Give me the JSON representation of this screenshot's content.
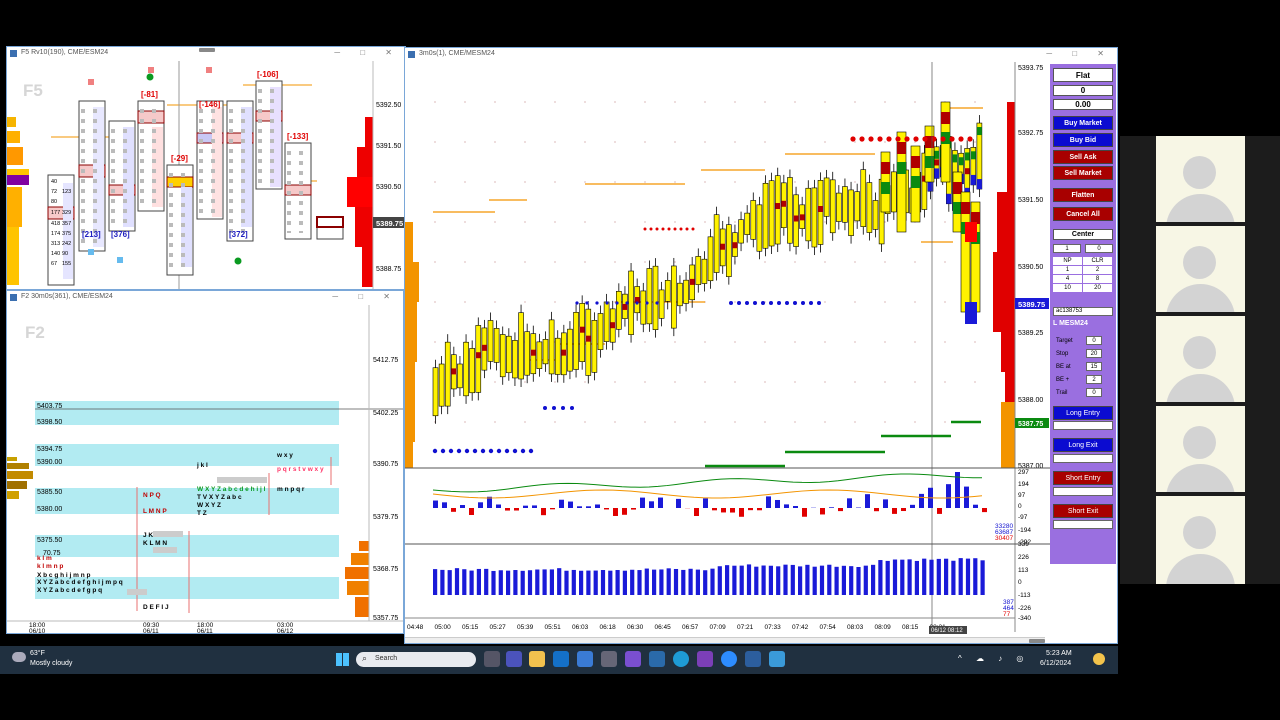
{
  "windows": {
    "left_top": {
      "title": "F5 Rv10(190), CME/ESM24",
      "big_label": "F5",
      "price_axis": [
        "5392.50",
        "5391.50",
        "5390.50",
        "5389.75",
        "5388.75"
      ],
      "current_price": "5389.75",
      "deltas": [
        "[-81]",
        "[-146]",
        "[-106]",
        "[-29]",
        "[-133]",
        "[213]",
        "[376]",
        "[372]"
      ],
      "footprint_numbers": [
        "40",
        "72",
        "80",
        "123",
        "177",
        "329",
        "418",
        "357",
        "174",
        "375",
        "313",
        "242",
        "140",
        "90",
        "67",
        "155"
      ]
    },
    "left_bottom": {
      "title": "F2 30m0s(361), CME/ESM24",
      "big_label": "F2",
      "price_axis": [
        "5412.75",
        "5402.25",
        "5390.75",
        "5379.75",
        "5368.75",
        "5357.75"
      ],
      "levels": [
        "5403.75",
        "5398.50",
        "5394.75",
        "5390.00",
        "5385.50",
        "5380.00",
        "5375.50",
        "70.75"
      ],
      "tpo_rows": [
        "W X Y Z",
        "T V X Y Z a b c",
        "k l m",
        "N P Q",
        "L M N P",
        "T Z",
        "J K L M N",
        "K L M N",
        "k l m n p",
        "X b c g h i j m n p",
        "X Y Z a b c d e f g h i j m p q",
        "X Y Z a b c d e f g p q",
        "w x y",
        "p q r s t v w x y",
        "j k l",
        "W X Y Z a b c d e h i j l",
        "m n p q r",
        "D E F I J"
      ],
      "dates": [
        "18:00\n06/10",
        "09:30\n06/11",
        "18:00\n06/11",
        "03:00\n06/12"
      ]
    },
    "main": {
      "title": "3m0s(1), CME/MESM24",
      "price_axis": [
        "5393.75",
        "5392.75",
        "5391.50",
        "5390.50",
        "5389.25",
        "5388.00",
        "5387.75",
        "5387.00"
      ],
      "current_price": "5389.75",
      "green_price": "5387.75",
      "time_axis": [
        "04:48",
        "05:00",
        "05:15",
        "05:27",
        "05:39",
        "05:51",
        "06:03",
        "06:18",
        "06:30",
        "06:45",
        "06:57",
        "07:09",
        "07:21",
        "07:33",
        "07:42",
        "07:54",
        "08:03",
        "08:09",
        "08:15",
        "08:21"
      ],
      "crosshair_time": "06/12 08:12",
      "osc_axis": [
        "297",
        "194",
        "97",
        "0",
        "-97",
        "-194",
        "-292"
      ],
      "osc_values": [
        "33280",
        "63687",
        "30407"
      ],
      "vol_axis": [
        "339",
        "226",
        "113",
        "0",
        "-113",
        "-226",
        "-340"
      ],
      "vol_values": [
        "387",
        "464",
        "77"
      ]
    }
  },
  "panel": {
    "status": "Flat",
    "position": "0",
    "pnl": "0.00",
    "buy_market": "Buy Market",
    "buy_bid": "Buy Bid",
    "sell_ask": "Sell Ask",
    "sell_market": "Sell Market",
    "flatten": "Flatten",
    "cancel_all": "Cancel All",
    "center": "Center",
    "qty": "1",
    "qty2": "0",
    "grid": [
      "NP",
      "CLR",
      "1",
      "2",
      "4",
      "8",
      "10",
      "20"
    ],
    "account": "ac138753",
    "symbol": "L MESM24",
    "target_label": "Target",
    "target": "0",
    "stop_label": "Stop",
    "stop": "20",
    "be_at_label": "BE at",
    "be_at": "15",
    "be_plus_label": "BE +",
    "be_plus": "2",
    "trail_label": "Trail",
    "trail": "0",
    "long_entry": "Long Entry",
    "long_exit": "Long Exit",
    "short_entry": "Short Entry",
    "short_exit": "Short Exit",
    "colors": {
      "blue": "#0b0bd0",
      "red": "#a80000",
      "purple": "#9a6fe0"
    }
  },
  "taskbar": {
    "weather_temp": "63°F",
    "weather_desc": "Mostly cloudy",
    "search_placeholder": "Search",
    "time": "5:23 AM",
    "date": "6/12/2024"
  }
}
